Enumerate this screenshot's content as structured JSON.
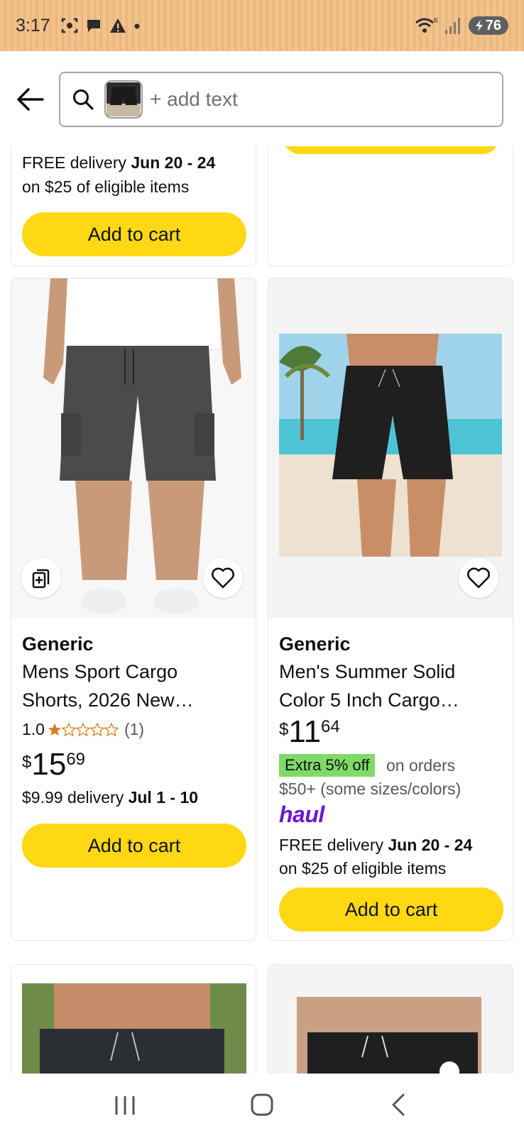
{
  "status_bar": {
    "time": "3:17",
    "battery": "76",
    "wifi_label": "6"
  },
  "search": {
    "placeholder": "+ add text"
  },
  "top_card": {
    "delivery_prefix": "FREE delivery ",
    "delivery_dates": "Jun 20 - 24",
    "delivery_note": "on $25 of eligible items",
    "add_to_cart": "Add to cart"
  },
  "products": [
    {
      "brand": "Generic",
      "title_line1": "Mens Sport Cargo",
      "title_line2": "Shorts, 2026 New…",
      "rating": "1.0",
      "rating_count": "(1)",
      "price_symbol": "$",
      "price_whole": "15",
      "price_fraction": "69",
      "delivery_prefix": "$9.99 delivery ",
      "delivery_dates": "Jul 1 - 10",
      "add_to_cart": "Add to cart"
    },
    {
      "brand": "Generic",
      "title_line1": "Men's Summer Solid",
      "title_line2": "Color 5 Inch Cargo…",
      "price_symbol": "$",
      "price_whole": "11",
      "price_fraction": "64",
      "deal_badge": "Extra 5% off",
      "deal_suffix": " on orders",
      "deal_note": "$50+ (some sizes/colors)",
      "haul_label": "haul",
      "delivery_prefix": "FREE delivery ",
      "delivery_dates": "Jun 20 - 24",
      "delivery_note": "on $25 of eligible items",
      "add_to_cart": "Add to cart"
    }
  ],
  "colors": {
    "add_to_cart": "#ffd814",
    "deal_badge": "#7fda69",
    "haul": "#6b19d1",
    "star": "#de7921"
  }
}
